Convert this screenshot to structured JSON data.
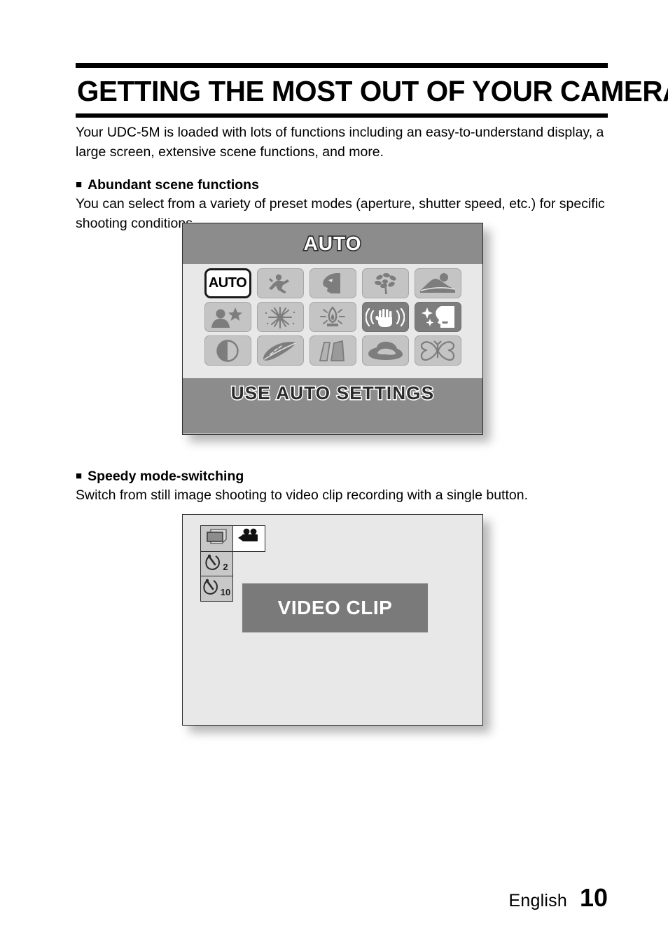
{
  "document": {
    "title": "GETTING THE MOST OUT OF YOUR CAMERA",
    "intro": "Your UDC-5M is loaded with lots of functions including an easy-to-understand display, a large screen, extensive scene functions, and more.",
    "sections": [
      {
        "heading": "Abundant scene functions",
        "body": "You can select from a variety of preset modes (aperture, shutter speed, etc.) for specific shooting conditions."
      },
      {
        "heading": "Speedy mode-switching",
        "body": "Switch from still image shooting to video clip recording with a single button."
      }
    ]
  },
  "scene_screen": {
    "osd_title": "AUTO",
    "osd_footer": "USE AUTO SETTINGS",
    "rows": [
      [
        {
          "name": "auto",
          "label": "AUTO",
          "selected": true,
          "style": "light"
        },
        {
          "name": "sports",
          "label": "",
          "selected": false,
          "style": "light"
        },
        {
          "name": "portrait",
          "label": "",
          "selected": false,
          "style": "light"
        },
        {
          "name": "flower-macro",
          "label": "",
          "selected": false,
          "style": "light"
        },
        {
          "name": "landscape",
          "label": "",
          "selected": false,
          "style": "light"
        }
      ],
      [
        {
          "name": "night-portrait",
          "label": "",
          "selected": false,
          "style": "light"
        },
        {
          "name": "fireworks",
          "label": "",
          "selected": false,
          "style": "light"
        },
        {
          "name": "lamp-night-scene",
          "label": "",
          "selected": false,
          "style": "light"
        },
        {
          "name": "image-stabilizer",
          "label": "",
          "selected": false,
          "style": "dark"
        },
        {
          "name": "sparkle-face",
          "label": "",
          "selected": false,
          "style": "dark"
        }
      ],
      [
        {
          "name": "contrast",
          "label": "",
          "selected": false,
          "style": "light"
        },
        {
          "name": "leaf",
          "label": "",
          "selected": false,
          "style": "light"
        },
        {
          "name": "pages-shutter",
          "label": "",
          "selected": false,
          "style": "light"
        },
        {
          "name": "beach-hat",
          "label": "",
          "selected": false,
          "style": "light"
        },
        {
          "name": "butterfly",
          "label": "",
          "selected": false,
          "style": "light"
        }
      ]
    ],
    "colors": {
      "band": "#8C8C8C",
      "panel": "#E8E8E8",
      "tile": "#C4C4C4",
      "tile_dark": "#7D7D7D"
    }
  },
  "video_screen": {
    "banner_text": "VIDEO CLIP",
    "mode_icons": [
      {
        "name": "still-image-mode",
        "selected": false
      },
      {
        "name": "video-clip-mode",
        "selected": true
      }
    ],
    "self_timer": [
      {
        "name": "self-timer-2s",
        "value": "2"
      },
      {
        "name": "self-timer-10s",
        "value": "10"
      }
    ],
    "colors": {
      "panel": "#E8E8E8",
      "banner": "#7A7A7A"
    }
  },
  "footer": {
    "language": "English",
    "page_number": "10"
  }
}
